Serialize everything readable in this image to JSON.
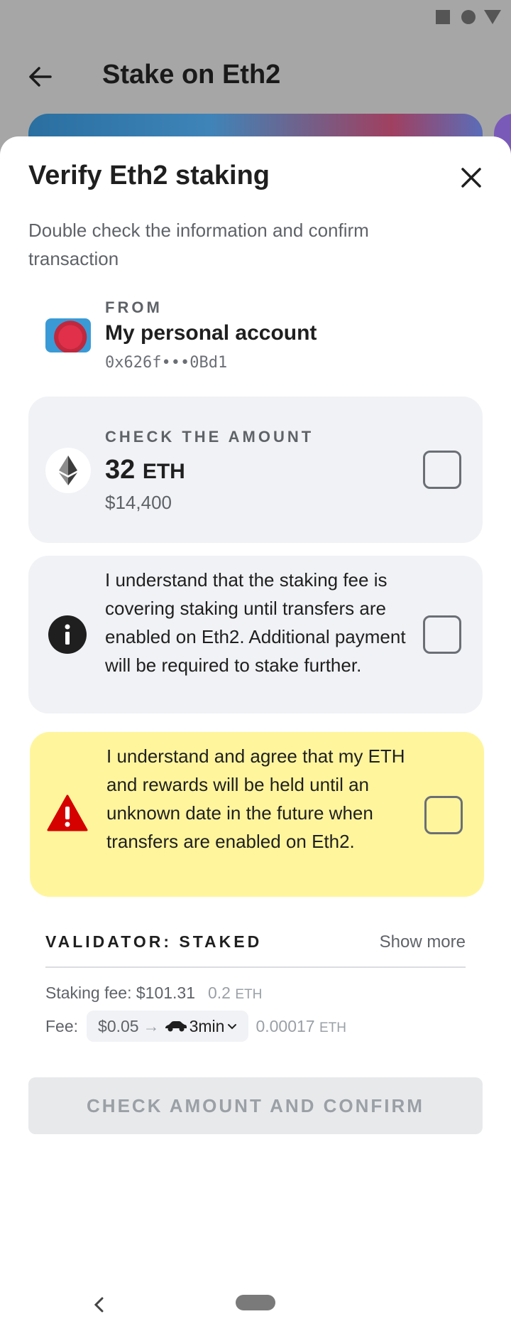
{
  "app_bar": {
    "title": "Stake on Eth2"
  },
  "sheet": {
    "title": "Verify Eth2 staking",
    "subtitle": "Double check the information and confirm transaction"
  },
  "from": {
    "label": "FROM",
    "account_name": "My personal account",
    "address": "0x626f•••0Bd1"
  },
  "amount": {
    "label": "CHECK THE AMOUNT",
    "value": "32",
    "unit": "ETH",
    "fiat": "$14,400",
    "checked": false
  },
  "acknowledgements": [
    {
      "text": "I understand that the staking fee is covering staking until transfers are enabled on Eth2. Additional payment will be required to stake further.",
      "checked": false
    },
    {
      "text": "I understand and agree that my ETH and rewards will be held until an unknown date in the future when transfers are enabled on Eth2.",
      "checked": false
    }
  ],
  "validator": {
    "label": "VALIDATOR: STAKED",
    "show_more": "Show more"
  },
  "fees": {
    "staking_fee_label": "Staking fee: $101.31",
    "staking_fee_eth_value": "0.2",
    "eth_unit": "ETH",
    "fee_label": "Fee:",
    "fee_fiat": "$0.05",
    "arrow": "→",
    "speed_time": "3min",
    "fee_eth_value": "0.00017"
  },
  "confirm_button": {
    "label": "CHECK AMOUNT AND CONFIRM",
    "enabled": false
  },
  "colors": {
    "warning_bg": "#fff59d",
    "card_bg": "#f1f2f5",
    "warning_icon": "#d50000",
    "scrim": "#a6a6a6"
  },
  "icons": {
    "back": "arrow-left-icon",
    "close": "close-icon",
    "eth": "ethereum-icon",
    "info": "info-icon",
    "warning": "warning-icon",
    "speed": "car-icon"
  }
}
